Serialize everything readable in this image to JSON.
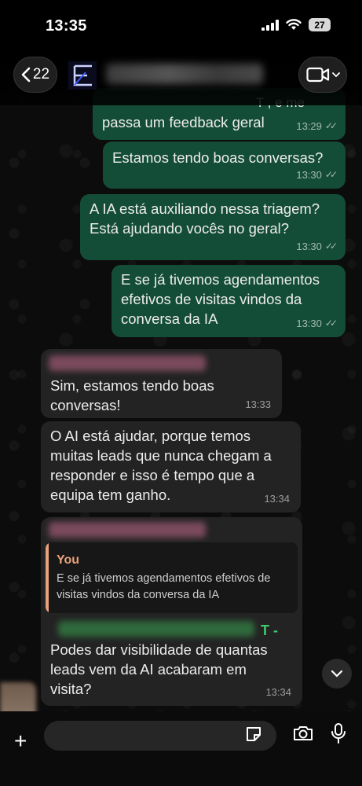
{
  "status_bar": {
    "time": "13:35",
    "battery": "27"
  },
  "header": {
    "back_count": "22"
  },
  "messages": [
    {
      "text": "passa um feedback geral",
      "time": "13:29"
    },
    {
      "text": "Estamos tendo boas conversas?",
      "time": "13:30"
    },
    {
      "text": "A IA está auxiliando nessa triagem?\nEstá ajudando vocês no geral?",
      "time": "13:30"
    },
    {
      "text": "E se já tivemos agendamentos\nefetivos de visitas vindos da\nconversa da IA",
      "time": "13:30"
    },
    {
      "text": "Sim, estamos tendo boas\nconversas!",
      "time": "13:33"
    },
    {
      "text": "O AI está ajudar, porque temos\nmuitas leads que nunca chegam a\nresponder e isso é tempo que a\nequipa tem ganho.",
      "time": "13:34"
    },
    {
      "quote_author": "You",
      "quote_text": "E se já tivemos agendamentos efetivos de visitas vindos da conversa da IA",
      "text": "Podes dar visibilidade de quantas\nleads vem da AI acabaram em\nvisita?",
      "time": "13:34",
      "name_suffix": "T -"
    }
  ],
  "header_partial_text": "T , e me",
  "icons": {
    "back": "chevron-left-icon",
    "video": "video-camera-icon",
    "scroll": "chevron-down-icon",
    "plus": "plus-icon",
    "sticker": "sticker-icon",
    "camera": "camera-icon",
    "mic": "microphone-icon"
  },
  "colors": {
    "outgoing": "#144d37",
    "incoming": "#232323",
    "quote_accent": "#e8a27c"
  }
}
